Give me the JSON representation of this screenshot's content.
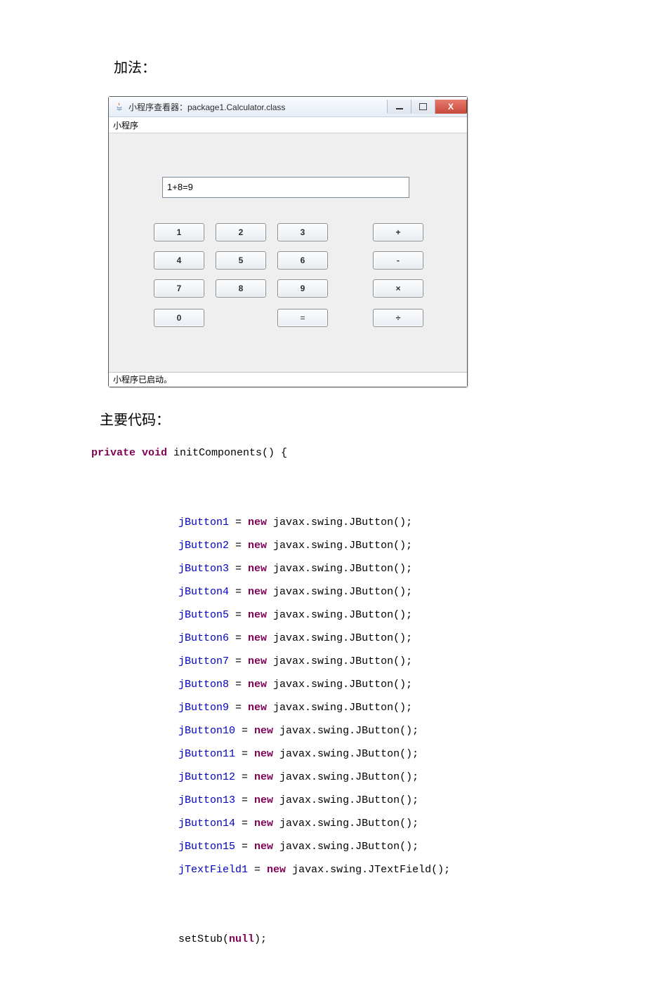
{
  "doc": {
    "caption_add": "加法：",
    "caption_code": "主要代码："
  },
  "win": {
    "title": "小程序查看器：package1.Calculator.class",
    "menu": "小程序",
    "status": "小程序已启动。",
    "display": "1+8=9",
    "buttons": {
      "b1": "1",
      "b2": "2",
      "b3": "3",
      "b4": "4",
      "b5": "5",
      "b6": "6",
      "b7": "7",
      "b8": "8",
      "b9": "9",
      "b0": "0",
      "beq": "=",
      "add": "+",
      "sub": "-",
      "mul": "×",
      "div": "÷"
    }
  },
  "code": {
    "sig_pre": "private void",
    "sig_post": " initComponents() {",
    "kw_new": "new",
    "kw_null": "null",
    "fields": {
      "jButton1": "jButton1",
      "jButton2": "jButton2",
      "jButton3": "jButton3",
      "jButton4": "jButton4",
      "jButton5": "jButton5",
      "jButton6": "jButton6",
      "jButton7": "jButton7",
      "jButton8": "jButton8",
      "jButton9": "jButton9",
      "jButton10": "jButton10",
      "jButton11": "jButton11",
      "jButton12": "jButton12",
      "jButton13": "jButton13",
      "jButton14": "jButton14",
      "jButton15": "jButton15",
      "jTextField1": "jTextField1"
    },
    "tail_btn": " javax.swing.JButton();",
    "tail_txt": " javax.swing.JTextField();",
    "setstub_pre": "setStub(",
    "setstub_post": ");"
  }
}
